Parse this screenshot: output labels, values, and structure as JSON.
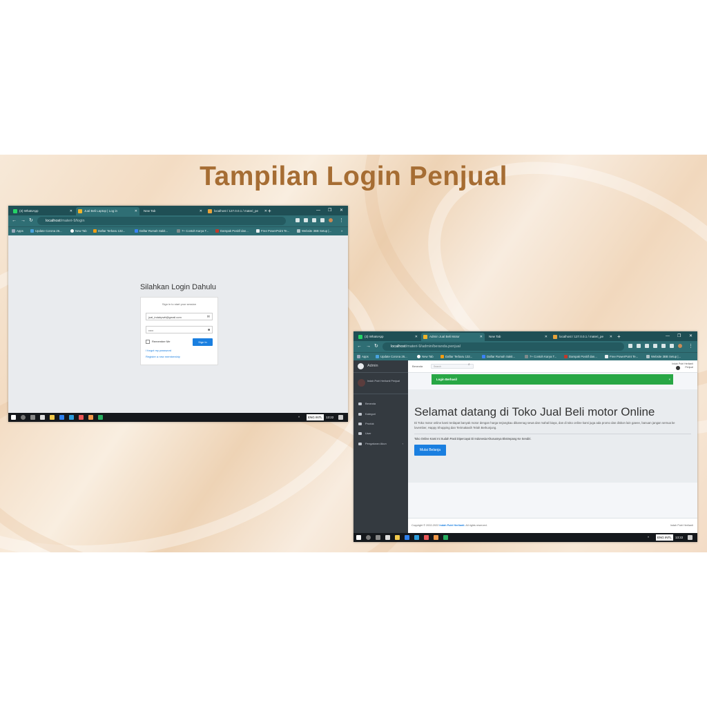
{
  "slide": {
    "title": "Tampilan Login Penjual",
    "title_color": "#a66d33"
  },
  "login_screen": {
    "tabs": [
      {
        "label": "(3) WhatsApp",
        "icon": "whatsapp-icon",
        "color": "#25d366"
      },
      {
        "label": "Jual Beli Laptop | Log in",
        "icon": "page-icon",
        "color": "#f0b429"
      },
      {
        "label": "New Tab",
        "icon": "",
        "color": ""
      },
      {
        "label": "localhost / 127.0.0.1 / materi_pe",
        "icon": "phpmyadmin-icon",
        "color": "#e8a33b"
      }
    ],
    "url_host": "localhost",
    "url_path": "/materi-9/login",
    "bookmarks": [
      "Apps",
      "Update Corona 26...",
      "New Tab",
      "Daftar Terbaru 132...",
      "Daftar Rumah Sakit...",
      "7+ Contoh Karya T...",
      "Dampak Positif dan...",
      "Free PowerPoint Te...",
      "Website 3BB Setup |..."
    ],
    "heading": "Silahkan Login Dahulu",
    "card_message": "Sign in to start your session",
    "email_value": "jual_indahpwtt@gmail.com",
    "password_value": "•••••",
    "remember_label": "Remember Me",
    "signin_label": "Sign In",
    "forgot_link": "I forgot my password",
    "register_link": "Register a new membership",
    "taskbar_time": "13:22",
    "taskbar_lang": "ENG INTL"
  },
  "admin_screen": {
    "tabs": [
      {
        "label": "(3) WhatsApp",
        "icon": "whatsapp-icon",
        "color": "#25d366"
      },
      {
        "label": "Admin Jual Beli Motor",
        "icon": "page-icon",
        "color": "#f0b429"
      },
      {
        "label": "New Tab",
        "icon": "",
        "color": ""
      },
      {
        "label": "localhost / 127.0.0.1 / materi_pe",
        "icon": "phpmyadmin-icon",
        "color": "#e8a33b"
      }
    ],
    "url_host": "localhost",
    "url_path": "/materi-9/admin/beranda.penjual",
    "bookmarks": [
      "Apps",
      "Update Corona 26...",
      "New Tab",
      "Daftar Terbaru 132...",
      "Daftar Rumah Sakit...",
      "7+ Contoh Karya T...",
      "Dampak Positif dan...",
      "Free PowerPoint Te...",
      "Website 3BB Setup |..."
    ],
    "brand": "Admin",
    "user_name": "Indah Putri Herlianti Penjual",
    "menu": [
      {
        "label": "Beranda",
        "icon": "home-icon"
      },
      {
        "label": "Kategori",
        "icon": "grid-icon"
      },
      {
        "label": "Produk",
        "icon": "box-icon"
      },
      {
        "label": "User",
        "icon": "user-icon"
      },
      {
        "label": "Pengaturan Akun",
        "icon": "gear-icon"
      }
    ],
    "nav_home": "Beranda",
    "search_placeholder": "Search",
    "nav_user": "Indah Putri Herlianti",
    "nav_user_role": "Penjual",
    "alert": "Login Berhasil",
    "welcome": "Selamat datang di Toko Jual Beli motor Online",
    "welcome_desc": "Di Toko motor online kami terdapat banyak motor dengan harga terjangkau dikarenag sewa dan mahal biaya, dan di toko online kami juga ada promo dan diskon lain gaeee, banuan jangan semua ke lovember, Happy Shopping dan Terimakasih Telah Berkunjung.",
    "sub_text": "Toko Online Kami Ini Sudah Pasti Dipercayai Di Indonesia Khususnya Ekstrepang Ke Sendiri.",
    "shop_button": "Mulai Belanja",
    "footer_prefix": "Copyright © 2002-2022",
    "footer_brand": "Indah Putri Herlianti.",
    "footer_suffix": "All rights reserved.",
    "footer_right": "Indah Putri Herlianti",
    "taskbar_time": "13:22",
    "taskbar_lang": "ENG INTL"
  }
}
